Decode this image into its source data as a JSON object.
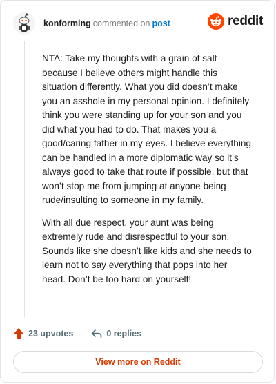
{
  "header": {
    "username": "konforming",
    "action_text": "commented on",
    "post_link": "post",
    "brand": "reddit"
  },
  "comment": {
    "paragraphs": [
      "NTA: Take my thoughts with a grain of salt because I believe others might handle this situation differently. What you did doesn’t make you an asshole in my personal opinion. I definitely think you were standing up for your son and you did what you had to do. That makes you a good/caring father in my eyes. I believe everything can be handled in a more diplomatic way so it’s always good to take that route if possible, but that won’t stop me from jumping at anyone being rude/insulting to someone in my family.",
      "With all due respect, your aunt was being extremely rude and disrespectful to your son. Sounds like she doesn’t like kids and she needs to learn not to say everything that pops into her head. Don’t be too hard on yourself!"
    ]
  },
  "actions": {
    "upvotes": "23 upvotes",
    "replies": "0 replies"
  },
  "footer": {
    "view_more": "View more on Reddit"
  },
  "colors": {
    "brand_orange": "#ff4500",
    "upvote": "#d93a00",
    "link_blue": "#0079d3"
  },
  "icons": {
    "avatar": "snoo-avatar-icon",
    "brand": "reddit-logo-icon",
    "upvote": "upvote-arrow-icon",
    "reply": "reply-arrow-icon"
  }
}
